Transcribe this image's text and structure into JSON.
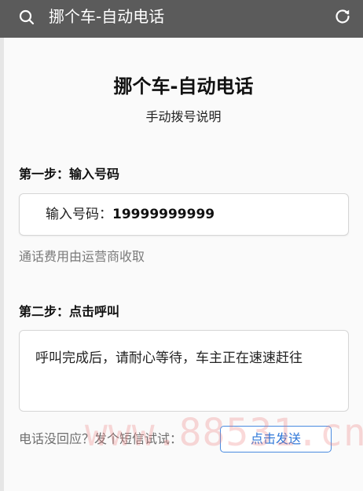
{
  "topbar": {
    "title": "挪个车-自动电话",
    "search_icon": "search-icon",
    "refresh_icon": "refresh-icon"
  },
  "main": {
    "title": "挪个车-自动电话",
    "subtitle": "手动拨号说明",
    "step1": {
      "heading": "第一步：输入号码",
      "number_label": "输入号码：",
      "number_value": "19999999999",
      "fee_note": "通话费用由运营商收取"
    },
    "step2": {
      "heading": "第二步：点击呼叫",
      "message": "呼叫完成后，请耐心等待，车主正在速速赶往"
    },
    "sms": {
      "prompt": "电话没回应？发个短信试试：",
      "button_label": "点击发送"
    }
  },
  "watermark": "www.88531.cn",
  "colors": {
    "topbar_bg": "#5b5b5b",
    "link_blue": "#2f77d8",
    "note_gray": "#7a7a7a",
    "watermark": "#ec7878"
  }
}
